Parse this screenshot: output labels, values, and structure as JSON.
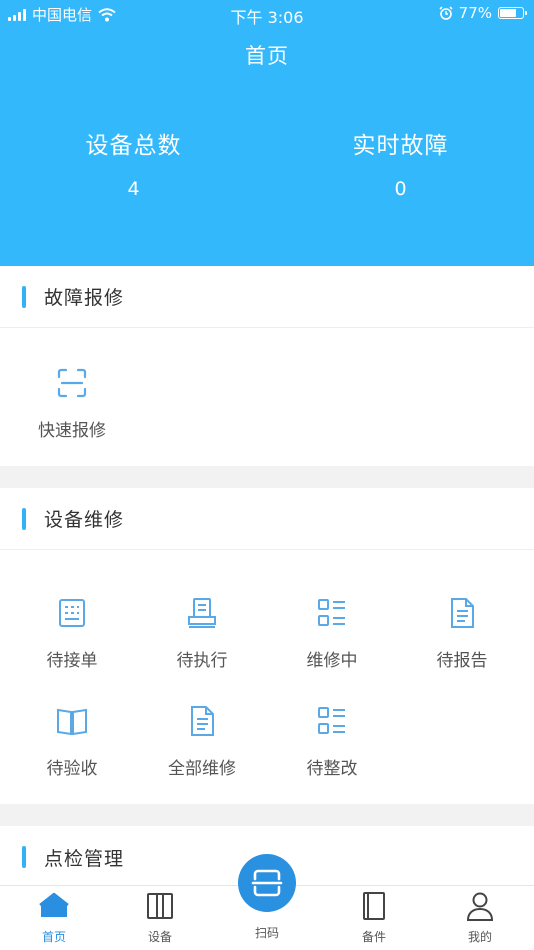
{
  "status_bar": {
    "carrier": "中国电信",
    "time": "下午 3:06",
    "battery_pct": "77%",
    "battery_level": 0.77
  },
  "header": {
    "title": "首页",
    "stats": [
      {
        "label": "设备总数",
        "value": "4"
      },
      {
        "label": "实时故障",
        "value": "0"
      }
    ]
  },
  "fault_section": {
    "title": "故障报修",
    "items": [
      {
        "label": "快速报修",
        "icon": "scan-frame-icon"
      }
    ]
  },
  "repair_section": {
    "title": "设备维修",
    "items": [
      {
        "label": "待接单",
        "icon": "order-list-icon"
      },
      {
        "label": "待执行",
        "icon": "printer-doc-icon"
      },
      {
        "label": "维修中",
        "icon": "grid-list-icon"
      },
      {
        "label": "待报告",
        "icon": "document-icon"
      },
      {
        "label": "待验收",
        "icon": "open-book-icon"
      },
      {
        "label": "全部维修",
        "icon": "document-icon"
      },
      {
        "label": "待整改",
        "icon": "grid-list-icon"
      }
    ]
  },
  "inspection_section": {
    "title": "点检管理"
  },
  "tabbar": {
    "tabs": [
      {
        "label": "首页",
        "icon": "home-icon",
        "active": true
      },
      {
        "label": "设备",
        "icon": "device-icon"
      },
      {
        "label": "扫码",
        "icon": "scan-icon"
      },
      {
        "label": "备件",
        "icon": "notebook-icon"
      },
      {
        "label": "我的",
        "icon": "user-icon"
      }
    ]
  },
  "colors": {
    "primary": "#33b8fb",
    "accent_bar": "#2fb3f5",
    "icon": "#5aa9e6",
    "tab_active": "#2a8fe0"
  }
}
